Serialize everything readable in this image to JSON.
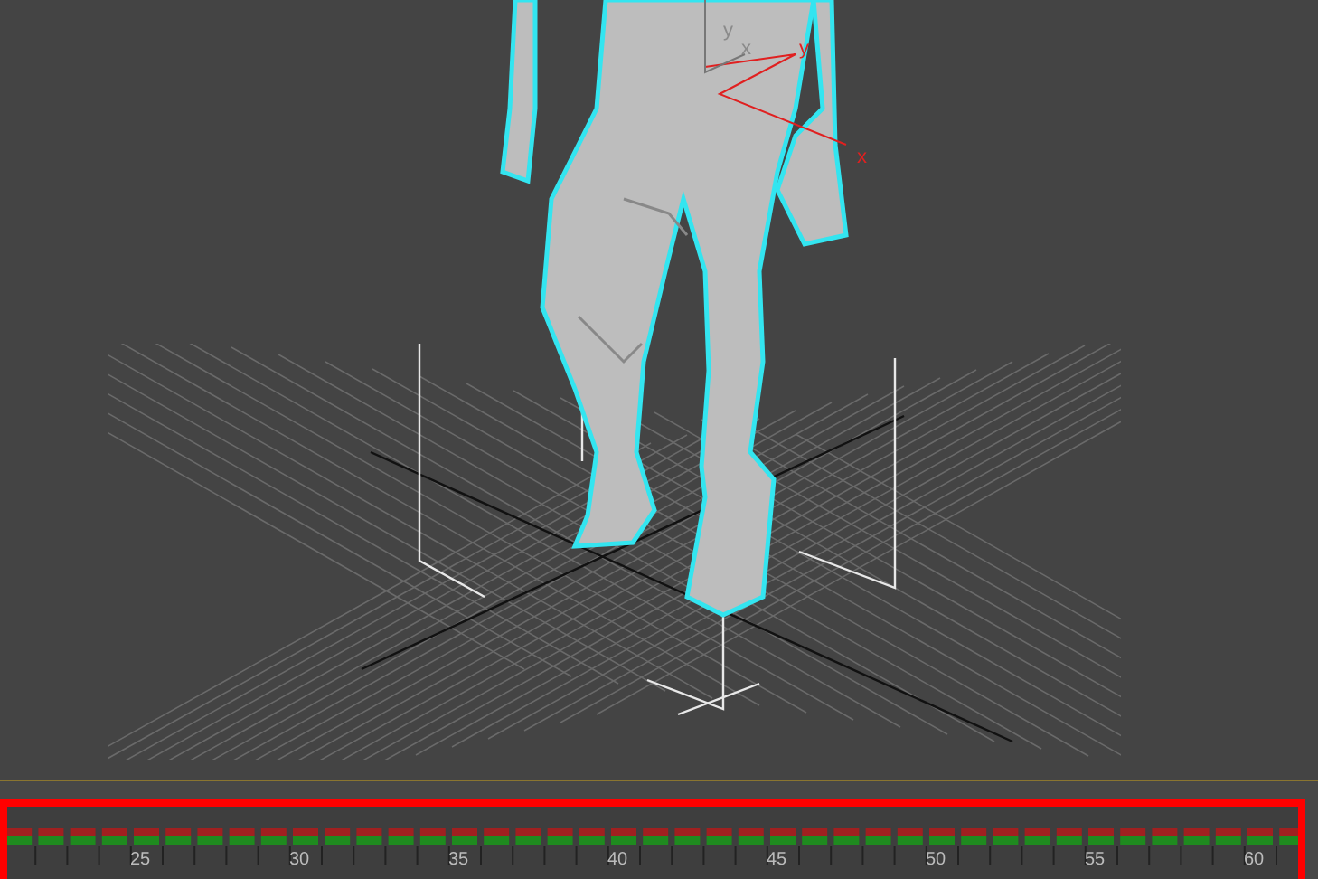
{
  "viewport": {
    "axis_labels": [
      {
        "text": "y",
        "kind": "grey"
      },
      {
        "text": "x",
        "kind": "grey"
      },
      {
        "text": "y",
        "kind": "red"
      },
      {
        "text": "x",
        "kind": "red"
      }
    ]
  },
  "timeline": {
    "highlighted": true,
    "tick_labels": [
      "25",
      "30",
      "35",
      "40",
      "45",
      "50",
      "55",
      "60"
    ]
  }
}
